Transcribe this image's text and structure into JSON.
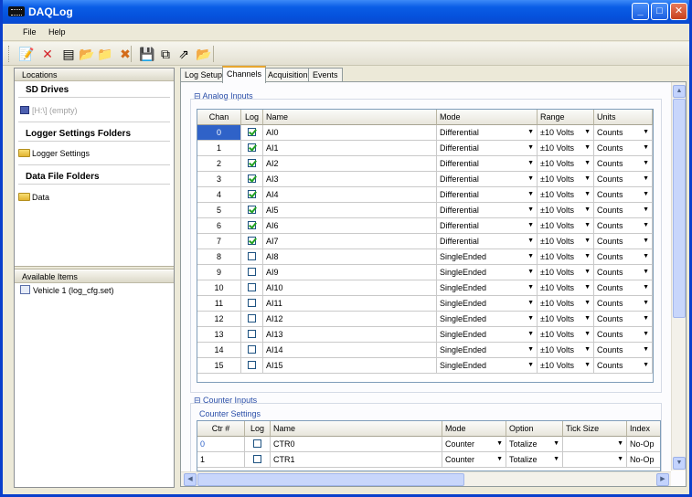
{
  "window": {
    "title": "DAQLog"
  },
  "menu": [
    "File",
    "Help"
  ],
  "toolbar": [
    {
      "name": "new-config-icon",
      "glyph": "📝"
    },
    {
      "name": "delete-icon",
      "glyph": "✕",
      "color": "#d4252b"
    },
    {
      "name": "sd-card-icon",
      "glyph": "▤"
    },
    {
      "name": "edit-folder-icon",
      "glyph": "📂"
    },
    {
      "name": "folder-icon",
      "glyph": "📁"
    },
    {
      "name": "remove-folder-icon",
      "glyph": "✖",
      "color": "#d36b1a"
    },
    {
      "name": "save-icon",
      "glyph": "💾"
    },
    {
      "name": "copy-icon",
      "glyph": "⧉"
    },
    {
      "name": "export-icon",
      "glyph": "⇗"
    },
    {
      "name": "open-folder-icon",
      "glyph": "📂"
    }
  ],
  "left": {
    "locations_header": "Locations",
    "sd_drives": "SD Drives",
    "sd_item": "[H:\\] (empty)",
    "logger_folders": "Logger Settings Folders",
    "logger_item": "Logger Settings",
    "data_folders": "Data File Folders",
    "data_item": "Data",
    "available_header": "Available Items",
    "available_item": "Vehicle 1 (log_cfg.set)"
  },
  "tabs": [
    "Log Setup",
    "Channels",
    "Acquisition",
    "Events"
  ],
  "active_tab": "Channels",
  "analog": {
    "label": "⊟ Analog Inputs",
    "columns": [
      "Chan",
      "Log",
      "Name",
      "Mode",
      "Range",
      "Units"
    ],
    "rows": [
      {
        "chan": "0",
        "log": true,
        "name": "AI0",
        "mode": "Differential",
        "range": "±10 Volts",
        "units": "Counts"
      },
      {
        "chan": "1",
        "log": true,
        "name": "AI1",
        "mode": "Differential",
        "range": "±10 Volts",
        "units": "Counts"
      },
      {
        "chan": "2",
        "log": true,
        "name": "AI2",
        "mode": "Differential",
        "range": "±10 Volts",
        "units": "Counts"
      },
      {
        "chan": "3",
        "log": true,
        "name": "AI3",
        "mode": "Differential",
        "range": "±10 Volts",
        "units": "Counts"
      },
      {
        "chan": "4",
        "log": true,
        "name": "AI4",
        "mode": "Differential",
        "range": "±10 Volts",
        "units": "Counts"
      },
      {
        "chan": "5",
        "log": true,
        "name": "AI5",
        "mode": "Differential",
        "range": "±10 Volts",
        "units": "Counts"
      },
      {
        "chan": "6",
        "log": true,
        "name": "AI6",
        "mode": "Differential",
        "range": "±10 Volts",
        "units": "Counts"
      },
      {
        "chan": "7",
        "log": true,
        "name": "AI7",
        "mode": "Differential",
        "range": "±10 Volts",
        "units": "Counts"
      },
      {
        "chan": "8",
        "log": false,
        "name": "AI8",
        "mode": "SingleEnded",
        "range": "±10 Volts",
        "units": "Counts"
      },
      {
        "chan": "9",
        "log": false,
        "name": "AI9",
        "mode": "SingleEnded",
        "range": "±10 Volts",
        "units": "Counts"
      },
      {
        "chan": "10",
        "log": false,
        "name": "AI10",
        "mode": "SingleEnded",
        "range": "±10 Volts",
        "units": "Counts"
      },
      {
        "chan": "11",
        "log": false,
        "name": "AI11",
        "mode": "SingleEnded",
        "range": "±10 Volts",
        "units": "Counts"
      },
      {
        "chan": "12",
        "log": false,
        "name": "AI12",
        "mode": "SingleEnded",
        "range": "±10 Volts",
        "units": "Counts"
      },
      {
        "chan": "13",
        "log": false,
        "name": "AI13",
        "mode": "SingleEnded",
        "range": "±10 Volts",
        "units": "Counts"
      },
      {
        "chan": "14",
        "log": false,
        "name": "AI14",
        "mode": "SingleEnded",
        "range": "±10 Volts",
        "units": "Counts"
      },
      {
        "chan": "15",
        "log": false,
        "name": "AI15",
        "mode": "SingleEnded",
        "range": "±10 Volts",
        "units": "Counts"
      }
    ]
  },
  "counter": {
    "label": "⊟ Counter Inputs",
    "settings_label": "Counter Settings",
    "columns": [
      "Ctr #",
      "Log",
      "Name",
      "Mode",
      "Option",
      "Tick Size",
      "Index"
    ],
    "rows": [
      {
        "ctr": "0",
        "log": false,
        "name": "CTR0",
        "mode": "Counter",
        "option": "Totalize",
        "tick": "",
        "index": "No-Op"
      },
      {
        "ctr": "1",
        "log": false,
        "name": "CTR1",
        "mode": "Counter",
        "option": "Totalize",
        "tick": "",
        "index": "No-Op"
      }
    ]
  },
  "colors": {
    "accent": "#2f62c8",
    "titlebar": "#0a5de6",
    "check": "#21a121"
  }
}
